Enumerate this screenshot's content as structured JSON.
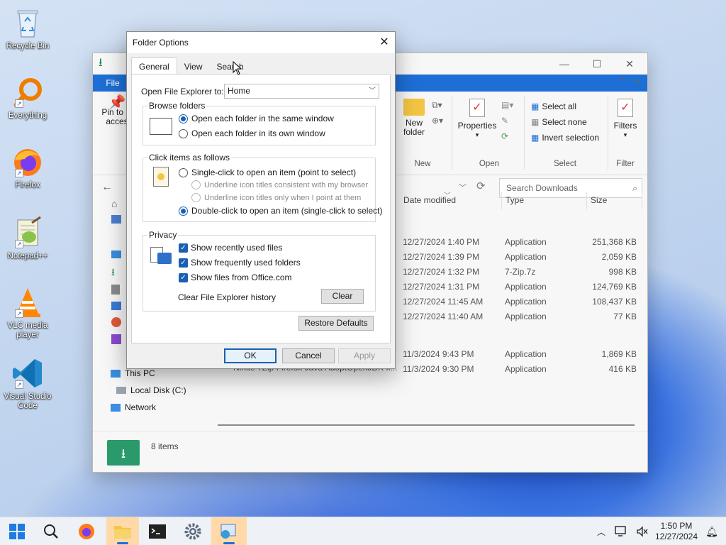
{
  "desktop": {
    "icons": [
      {
        "label": "Recycle Bin"
      },
      {
        "label": "Everything"
      },
      {
        "label": "Firefox"
      },
      {
        "label": "Notepad++"
      },
      {
        "label": "VLC media player"
      },
      {
        "label": "Visual Studio Code"
      }
    ]
  },
  "explorer": {
    "file_tab": "File",
    "ribbon": {
      "pin_label": "Pin to Q",
      "pin_label2": "acces",
      "new_folder": "New folder",
      "properties": "Properties",
      "select_all": "Select all",
      "select_none": "Select none",
      "invert_selection": "Invert selection",
      "filters": "Filters",
      "groups": {
        "new": "New",
        "open": "Open",
        "select": "Select",
        "filter": "Filter"
      }
    },
    "search_placeholder": "Search Downloads",
    "columns": {
      "date": "Date modified",
      "type": "Type",
      "size": "Size"
    },
    "files": [
      {
        "date": "12/27/2024 1:40 PM",
        "type": "Application",
        "size": "251,368 KB"
      },
      {
        "date": "12/27/2024 1:39 PM",
        "type": "Application",
        "size": "2,059 KB"
      },
      {
        "date": "12/27/2024 1:32 PM",
        "type": "7-Zip.7z",
        "size": "998 KB"
      },
      {
        "date": "12/27/2024 1:31 PM",
        "type": "Application",
        "size": "124,769 KB"
      },
      {
        "date": "12/27/2024 11:45 AM",
        "type": "Application",
        "size": "108,437 KB"
      },
      {
        "date": "12/27/2024 11:40 AM",
        "type": "Application",
        "size": "77 KB"
      },
      {
        "date": "11/3/2024 9:43 PM",
        "type": "Application",
        "size": "1,869 KB"
      },
      {
        "date": "11/3/2024 9:30 PM",
        "type": "Application",
        "size": "416 KB"
      }
    ],
    "partial_name": "Ninite 7Zip Firefox Java AdoptOpenJDK x...",
    "nav": {
      "this_pc": "This PC",
      "local_disk": "Local Disk (C:)",
      "network": "Network"
    },
    "status": "8 items"
  },
  "dialog": {
    "title": "Folder Options",
    "tabs": [
      "General",
      "View",
      "Search"
    ],
    "open_label": "Open File Explorer to:",
    "open_value": "Home",
    "browse": {
      "title": "Browse folders",
      "same_window": "Open each folder in the same window",
      "own_window": "Open each folder in its own window"
    },
    "click": {
      "title": "Click items as follows",
      "single": "Single-click to open an item (point to select)",
      "underline_browser": "Underline icon titles consistent with my browser",
      "underline_point": "Underline icon titles only when I point at them",
      "double": "Double-click to open an item (single-click to select)"
    },
    "privacy": {
      "title": "Privacy",
      "recent_files": "Show recently used files",
      "frequent_folders": "Show frequently used folders",
      "office_files": "Show files from Office.com",
      "clear_history": "Clear File Explorer history",
      "clear_button": "Clear"
    },
    "restore_defaults": "Restore Defaults",
    "ok": "OK",
    "cancel": "Cancel",
    "apply": "Apply"
  },
  "taskbar": {
    "time": "1:50 PM",
    "date": "12/27/2024"
  },
  "colors": {
    "accent": "#1a5fb4",
    "ribbon_blue": "#1d6fd6",
    "taskbar_active": "#ffd9a8"
  }
}
